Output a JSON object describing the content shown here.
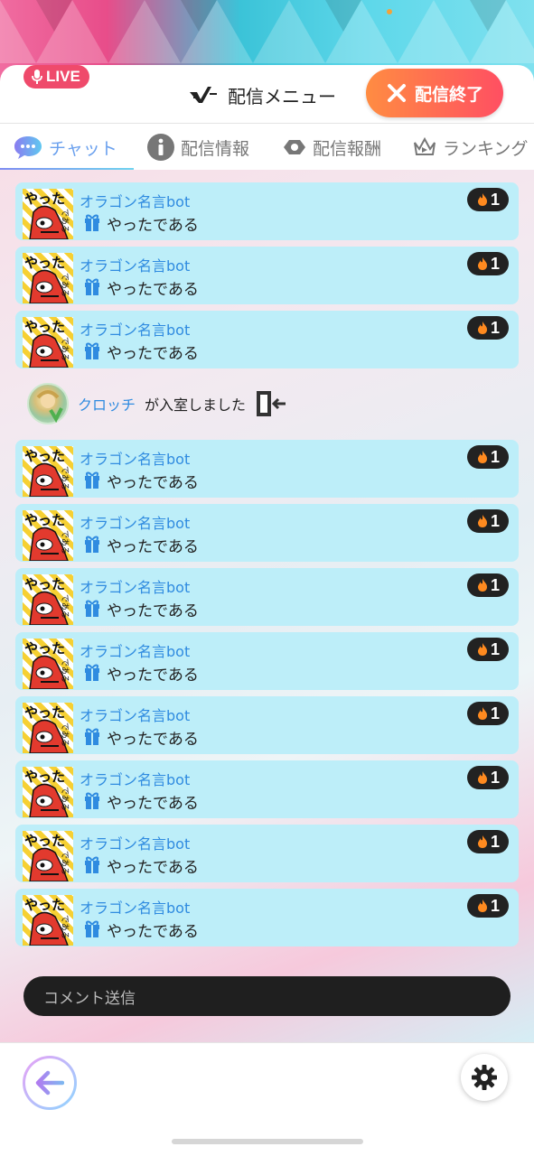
{
  "header": {
    "live_label": "LIVE",
    "menu_label": "配信メニュー",
    "end_button_label": "配信終了"
  },
  "tabs": [
    {
      "label": "チャット",
      "icon": "chat-bubble-icon",
      "active": true
    },
    {
      "label": "配信情報",
      "icon": "info-icon",
      "active": false
    },
    {
      "label": "配信報酬",
      "icon": "reward-icon",
      "active": false
    },
    {
      "label": "ランキング",
      "icon": "crown-icon",
      "active": false
    }
  ],
  "messages_top": [
    {
      "name": "オラゴン名言bot",
      "text": "やったである",
      "badge": "1"
    },
    {
      "name": "オラゴン名言bot",
      "text": "やったである",
      "badge": "1"
    },
    {
      "name": "オラゴン名言bot",
      "text": "やったである",
      "badge": "1"
    }
  ],
  "enter_event": {
    "name": "クロッチ",
    "text": "が入室しました"
  },
  "messages_bottom": [
    {
      "name": "オラゴン名言bot",
      "text": "やったである",
      "badge": "1"
    },
    {
      "name": "オラゴン名言bot",
      "text": "やったである",
      "badge": "1"
    },
    {
      "name": "オラゴン名言bot",
      "text": "やったである",
      "badge": "1"
    },
    {
      "name": "オラゴン名言bot",
      "text": "やったである",
      "badge": "1"
    },
    {
      "name": "オラゴン名言bot",
      "text": "やったである",
      "badge": "1"
    },
    {
      "name": "オラゴン名言bot",
      "text": "やったである",
      "badge": "1"
    },
    {
      "name": "オラゴン名言bot",
      "text": "やったである",
      "badge": "1"
    },
    {
      "name": "オラゴン名言bot",
      "text": "やったである",
      "badge": "1"
    }
  ],
  "avatar_text": "やったである",
  "comment": {
    "placeholder": "コメント送信"
  },
  "colors": {
    "accent_pink": "#ef4a6b",
    "end_gradient_start": "#ff8c42",
    "end_gradient_end": "#ff4f62",
    "message_bg": "#bdeef9",
    "name_blue": "#2f8be0",
    "badge_dark": "#222222"
  }
}
